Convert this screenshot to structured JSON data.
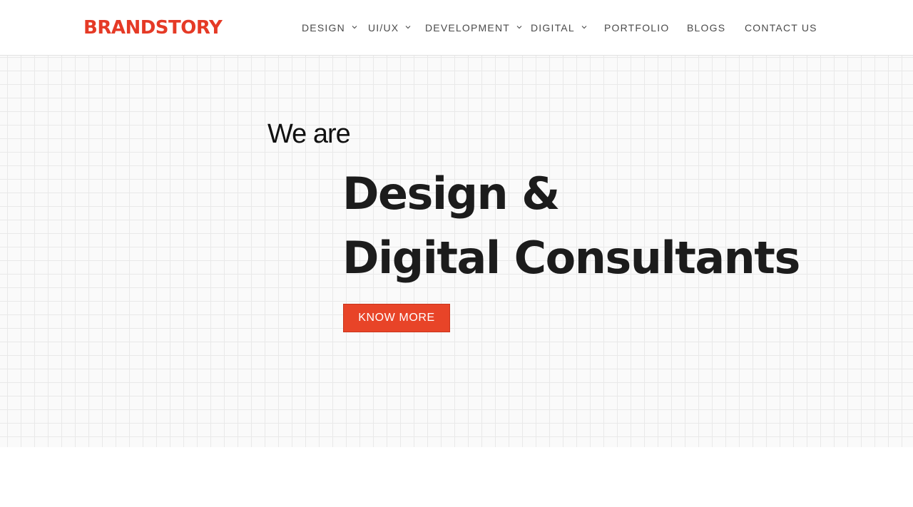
{
  "brand": {
    "logo_text": "BRANDSTORY",
    "color": "#e53a26"
  },
  "nav": {
    "items": [
      {
        "label": "DESIGN",
        "has_dropdown": true
      },
      {
        "label": "UI/UX",
        "has_dropdown": true
      },
      {
        "label": "DEVELOPMENT",
        "has_dropdown": true
      },
      {
        "label": "DIGITAL",
        "has_dropdown": true
      },
      {
        "label": "PORTFOLIO",
        "has_dropdown": false
      },
      {
        "label": "BLOGS",
        "has_dropdown": false
      },
      {
        "label": "CONTACT US",
        "has_dropdown": false
      }
    ]
  },
  "hero": {
    "intro": "We are",
    "headline_line1": "Design &",
    "headline_line2": "Digital Consultants",
    "cta_label": "KNOW MORE",
    "accent_color": "#e84428"
  }
}
